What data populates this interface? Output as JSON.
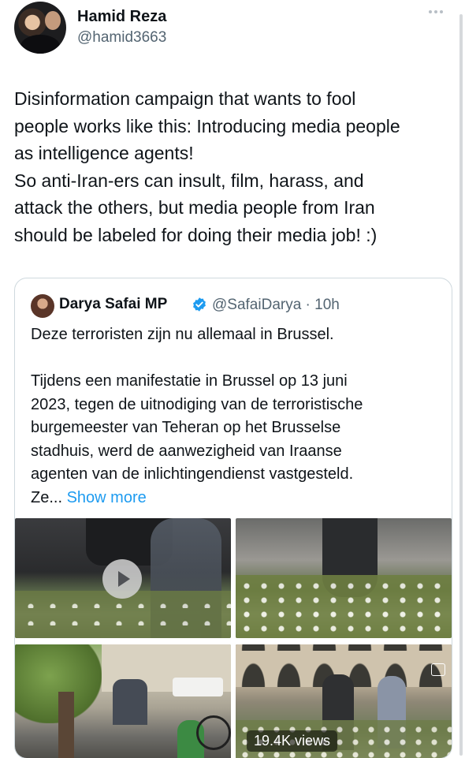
{
  "author": {
    "name": "Hamid Reza",
    "handle": "@hamid3663"
  },
  "tweet": {
    "text": "Disinformation campaign that wants to fool\npeople works like this: Introducing media people\nas intelligence agents!\nSo anti-Iran-ers can insult, film, harass, and\nattack the others, but media people from Iran\nshould be labeled for doing their media job! :)"
  },
  "quoted": {
    "name": "Darya Safai MP",
    "handle_time": "@SafaiDarya · 10h",
    "text": "Deze terroristen zijn nu allemaal in Brussel.\n\nTijdens een manifestatie in Brussel op 13 juni\n2023, tegen de uitnodiging van de terroristische\nburgemeester van Teheran op het Brusselse\nstadhuis, werd de aanwezigheid van Iraanse\nagenten van de inlichtingendienst vastgesteld.\nZe... ",
    "show_more": "Show more",
    "views": "19.4K views"
  },
  "colors": {
    "accent": "#1d9bf0",
    "secondary_text": "#536471",
    "border": "#cfd9de"
  },
  "icons": [
    "more-icon",
    "verified-icon",
    "play-icon",
    "gif-icon"
  ]
}
